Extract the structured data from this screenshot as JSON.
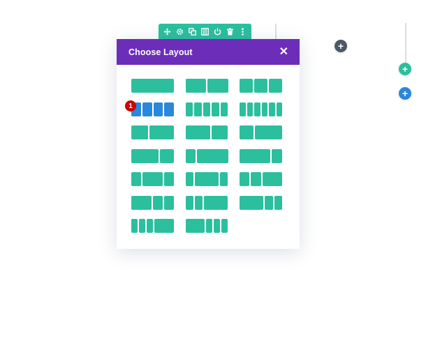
{
  "modal": {
    "title": "Choose Layout",
    "close_glyph": "✕"
  },
  "toolbar": {
    "icons": [
      "move-icon",
      "gear-icon",
      "duplicate-icon",
      "columns-icon",
      "power-icon",
      "trash-icon",
      "more-vertical-icon"
    ]
  },
  "badge": {
    "label": "1"
  },
  "circles": {
    "add_dark": "+",
    "add_teal": "+",
    "add_blue": "+"
  },
  "layouts": [
    {
      "name": "layout-1-1",
      "cols": [
        1
      ]
    },
    {
      "name": "layout-1-2-1-2",
      "cols": [
        1,
        1
      ]
    },
    {
      "name": "layout-1-3x3",
      "cols": [
        1,
        1,
        1
      ]
    },
    {
      "name": "layout-1-4x4",
      "cols": [
        1,
        1,
        1,
        1
      ],
      "active": true
    },
    {
      "name": "layout-1-5x5",
      "cols": [
        1,
        1,
        1,
        1,
        1
      ]
    },
    {
      "name": "layout-1-6x6",
      "cols": [
        1,
        1,
        1,
        1,
        1,
        1
      ]
    },
    {
      "name": "layout-2-5-3-5",
      "cols": [
        2,
        3
      ]
    },
    {
      "name": "layout-3-5-2-5",
      "cols": [
        3,
        2
      ]
    },
    {
      "name": "layout-1-3-2-3",
      "cols": [
        1,
        2
      ]
    },
    {
      "name": "layout-2-3-1-3",
      "cols": [
        2,
        1
      ]
    },
    {
      "name": "layout-1-4-3-4",
      "cols": [
        1,
        3
      ]
    },
    {
      "name": "layout-3-4-1-4",
      "cols": [
        3,
        1
      ]
    },
    {
      "name": "layout-1-4-1-2-1-4",
      "cols": [
        1,
        2,
        1
      ]
    },
    {
      "name": "layout-1-5-3-5-1-5",
      "cols": [
        1,
        3,
        1
      ]
    },
    {
      "name": "layout-1-4-1-4-1-2",
      "cols": [
        1,
        1,
        2
      ]
    },
    {
      "name": "layout-1-2-1-4-1-4",
      "cols": [
        2,
        1,
        1
      ]
    },
    {
      "name": "layout-1-5-1-5-3-5",
      "cols": [
        1,
        1,
        3
      ]
    },
    {
      "name": "layout-3-5-1-5-1-5",
      "cols": [
        3,
        1,
        1
      ]
    },
    {
      "name": "layout-1-6x3-1-2",
      "cols": [
        1,
        1,
        1,
        3
      ]
    },
    {
      "name": "layout-1-2-1-6x3",
      "cols": [
        3,
        1,
        1,
        1
      ]
    }
  ],
  "colors": {
    "header": "#6c2eb9",
    "column": "#2bbf9e",
    "column_active": "#2b87da",
    "badge": "#c90505",
    "toolbar": "#2bbf9e",
    "circle_dark": "#4c5866",
    "circle_blue": "#2b87da"
  }
}
